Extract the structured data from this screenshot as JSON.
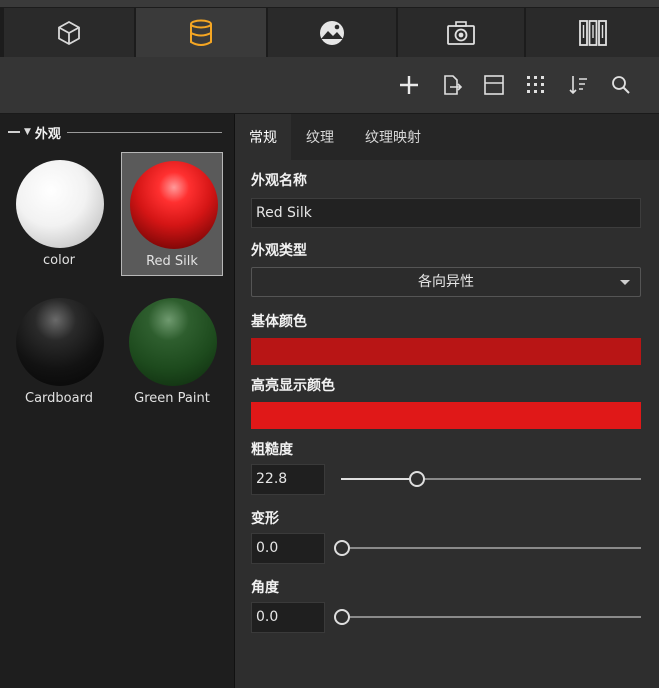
{
  "top_tabs": [
    {
      "icon": "cube-icon",
      "active": false
    },
    {
      "icon": "database-icon",
      "active": true
    },
    {
      "icon": "landscape-image-icon",
      "active": false
    },
    {
      "icon": "camera-icon",
      "active": false
    },
    {
      "icon": "columns-icon",
      "active": false
    }
  ],
  "accent_color": "#f5a623",
  "toolbar": {
    "icons": [
      "add-icon",
      "export-icon",
      "layout-icon",
      "grid-dots-icon",
      "sort-icon",
      "search-icon"
    ]
  },
  "library": {
    "section_title": "外观",
    "items": [
      {
        "label": "color",
        "color": "#ffffff",
        "selected": false
      },
      {
        "label": "Red Silk",
        "color": "#d41515",
        "selected": true
      },
      {
        "label": "Cardboard",
        "color": "#141414",
        "selected": false
      },
      {
        "label": "Green Paint",
        "color": "#1d4a1d",
        "selected": false
      }
    ]
  },
  "properties": {
    "tabs": [
      "常规",
      "纹理",
      "纹理映射"
    ],
    "active_tab": 0,
    "name_label": "外观名称",
    "name_value": "Red Silk",
    "type_label": "外观类型",
    "type_value": "各向异性",
    "base_color_label": "基体颜色",
    "base_color": "#b81515",
    "highlight_color_label": "高亮显示颜色",
    "highlight_color": "#e01818",
    "roughness_label": "粗糙度",
    "roughness_value": "22.8",
    "roughness_fraction": 0.25,
    "deform_label": "变形",
    "deform_value": "0.0",
    "deform_fraction": 0.0,
    "angle_label": "角度",
    "angle_value": "0.0",
    "angle_fraction": 0.0
  }
}
